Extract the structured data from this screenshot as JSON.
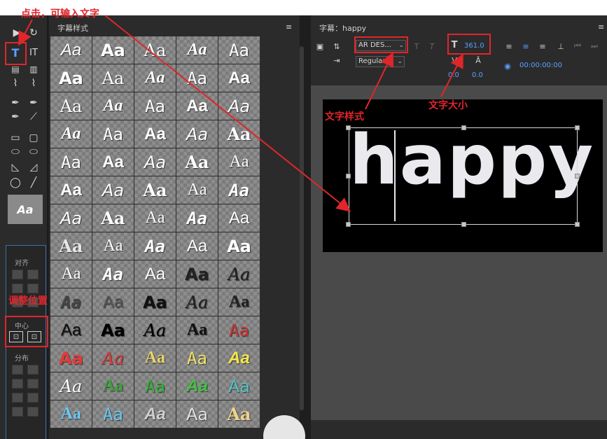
{
  "annotations": {
    "click_to_type": "点击，可输入文字",
    "font_style": "文字样式",
    "font_size": "文字大小",
    "align_position": "调整位置"
  },
  "tools_panel": {
    "preview_text": "Aa",
    "align_label": "对齐",
    "center_label": "中心",
    "distribute_label": "分布"
  },
  "styles_panel": {
    "title": "字幕样式",
    "sample_text": "Aa",
    "swatch_colors": [
      [
        "#ffffff",
        "#ffffff",
        "#ffffff",
        "#ffffff",
        "#ffffff"
      ],
      [
        "#ffffff",
        "#ffffff",
        "#ffffff",
        "#ffffff",
        "#ffffff"
      ],
      [
        "#ffffff",
        "#ffffff",
        "#ffffff",
        "#ffffff",
        "#ffffff"
      ],
      [
        "#ffffff",
        "#ffffff",
        "#ffffff",
        "#ffffff",
        "#ffffff"
      ],
      [
        "#ffffff",
        "#ffffff",
        "#ffffff",
        "#ffffff",
        "#ffffff"
      ],
      [
        "#ffffff",
        "#ffffff",
        "#ffffff",
        "#ffffff",
        "#ffffff"
      ],
      [
        "#ffffff",
        "#ffffff",
        "#ffffff",
        "#ffffff",
        "#ffffff"
      ],
      [
        "#e6e6e6",
        "#ffffff",
        "#ffffff",
        "#ffffff",
        "#ffffff"
      ],
      [
        "#ffffff",
        "#ffffff",
        "#ffffff",
        "#222222",
        "#222222"
      ],
      [
        "#444444",
        "#555555",
        "#111111",
        "#222222",
        "#222222"
      ],
      [
        "#111111",
        "#000000",
        "#000000",
        "#111111",
        "#cc3333"
      ],
      [
        "#e23a3a",
        "#e23a3a",
        "#e8d36a",
        "#efe36a",
        "#f2e84a"
      ],
      [
        "#ffffff",
        "#3aa43a",
        "#34b334",
        "#45c045",
        "#55c0c0"
      ],
      [
        "#6cc8f0",
        "#6cc8f0",
        "#cfcfcf",
        "#e0e0e0",
        "#efd38a"
      ]
    ]
  },
  "caption_panel": {
    "title": "字幕：happy",
    "font_family": "AR DES...",
    "font_weight": "Regular",
    "font_size": "361.0",
    "kerning": "0.0",
    "leading": "0.0",
    "timecode": "00:00:00:00",
    "caption_text": "happy"
  }
}
